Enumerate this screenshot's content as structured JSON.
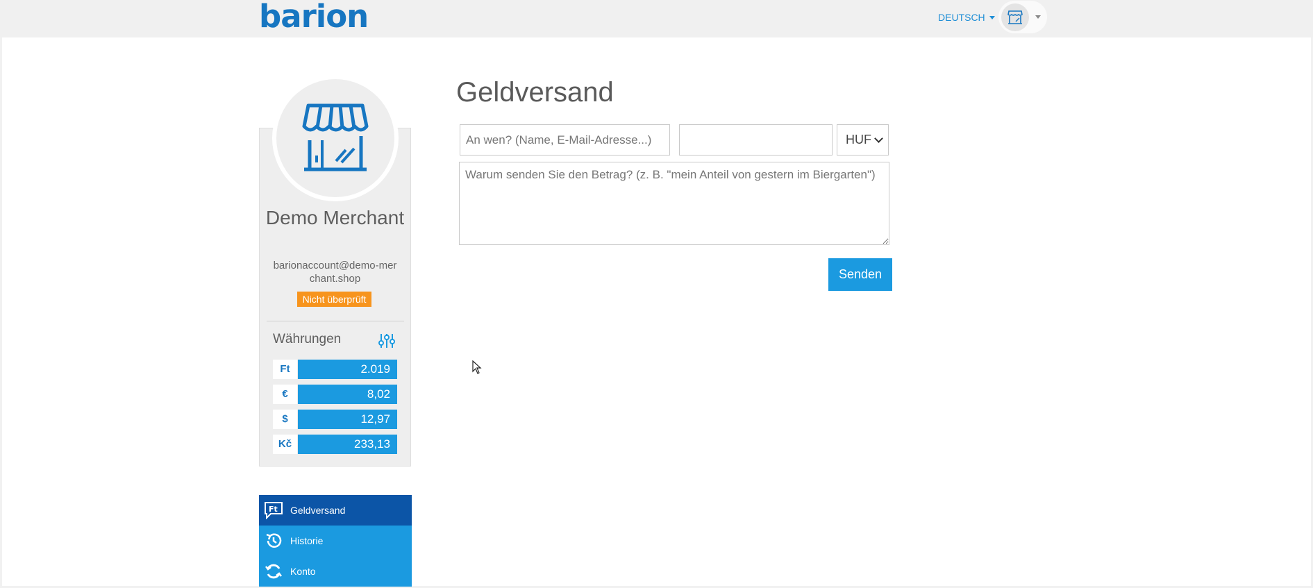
{
  "brand": {
    "logo_text": "barion",
    "accent": "#1b9ae0",
    "dark_accent": "#0c55a7"
  },
  "header": {
    "language": "DEUTSCH",
    "user_icon": "shop-icon"
  },
  "profile": {
    "avatar_icon": "storefront-icon",
    "name": "Demo Merchant",
    "email": "barionaccount@demo-merchant.shop",
    "status_badge": "Nicht überprüft",
    "status_color": "#f7941d"
  },
  "currencies": {
    "title": "Währungen",
    "settings_icon": "sliders-icon",
    "items": [
      {
        "symbol": "Ft",
        "amount": "2.019"
      },
      {
        "symbol": "€",
        "amount": "8,02"
      },
      {
        "symbol": "$",
        "amount": "12,97"
      },
      {
        "symbol": "Kč",
        "amount": "233,13"
      }
    ]
  },
  "nav": {
    "items": [
      {
        "label": "Geldversand",
        "icon": "money-message-icon",
        "active": true
      },
      {
        "label": "Historie",
        "icon": "history-icon",
        "active": false
      },
      {
        "label": "Konto",
        "icon": "refresh-icon",
        "active": false
      }
    ]
  },
  "form": {
    "title": "Geldversand",
    "recipient_placeholder": "An wen? (Name, E-Mail-Adresse...)",
    "recipient_value": "",
    "amount_value": "",
    "currency_selected": "HUF",
    "comment_placeholder": "Warum senden Sie den Betrag? (z. B. \"mein Anteil von gestern im Biergarten\")",
    "send_label": "Senden"
  }
}
